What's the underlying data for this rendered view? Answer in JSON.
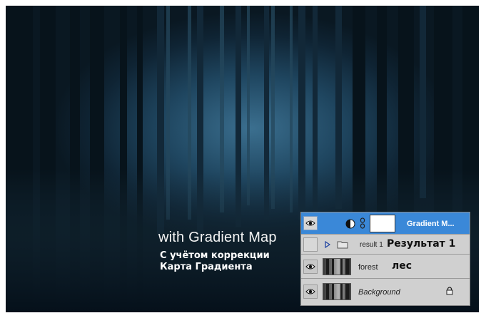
{
  "captions": {
    "english": "with Gradient Map",
    "russian_line1": "С учётом коррекции",
    "russian_line2": "Карта Градиента"
  },
  "layers_panel": {
    "layers": [
      {
        "name": "Gradient M...",
        "type": "adjustment-gradient-map",
        "visible": true,
        "selected": true,
        "italic": false,
        "annotation": ""
      },
      {
        "name": "result 1",
        "type": "group",
        "visible": false,
        "selected": false,
        "italic": false,
        "annotation": "Результат 1"
      },
      {
        "name": "forest",
        "type": "image",
        "visible": true,
        "selected": false,
        "italic": false,
        "annotation": "лес"
      },
      {
        "name": "Background",
        "type": "image",
        "visible": true,
        "selected": false,
        "italic": true,
        "annotation": "",
        "locked": true
      }
    ]
  },
  "icons": [
    "eye-icon",
    "adjustment-layer-icon",
    "chain-link-icon",
    "disclosure-triangle-icon",
    "folder-icon",
    "lock-icon"
  ],
  "colors": {
    "selected_layer": "#3a88d8",
    "panel_bg": "#d4d4d4",
    "scene_glow": "#3b6f8f",
    "scene_dark": "#0a1822"
  }
}
